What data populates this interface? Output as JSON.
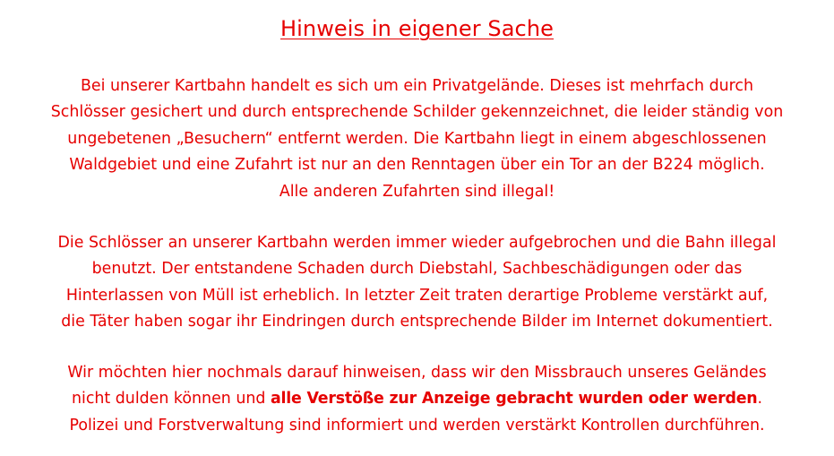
{
  "document": {
    "title": "Hinweis in eigener Sache",
    "text_color": "#e60000",
    "background_color": "#ffffff",
    "paragraph1": [
      "Bei unserer Kartbahn handelt es sich um ein Privatgelände. Dieses ist mehrfach durch",
      "Schlösser gesichert und durch entsprechende Schilder gekennzeichnet, die leider ständig von",
      "ungebetenen „Besuchern“ entfernt werden. Die Kartbahn liegt in einem abgeschlossenen",
      "Waldgebiet und eine Zufahrt ist nur an den Renntagen über ein Tor an der B224 möglich.",
      "Alle anderen Zufahrten sind illegal!"
    ],
    "paragraph2": [
      "Die Schlösser an unserer Kartbahn werden immer wieder aufgebrochen und die Bahn illegal",
      "benutzt. Der entstandene Schaden durch Diebstahl, Sachbeschädigungen oder das",
      "Hinterlassen von Müll ist erheblich. In letzter Zeit traten derartige Probleme verstärkt auf,",
      "die Täter haben sogar ihr Eindringen durch entsprechende Bilder im Internet dokumentiert."
    ],
    "paragraph3": {
      "line1": "Wir möchten hier nochmals darauf hinweisen, dass wir den Missbrauch unseres Geländes",
      "line2_prefix": "nicht dulden können und ",
      "line2_bold": "alle Verstöße zur Anzeige gebracht wurden oder werden",
      "line2_suffix": ".",
      "line3": "Polizei und Forstverwaltung sind informiert und werden verstärkt Kontrollen durchführen."
    }
  }
}
